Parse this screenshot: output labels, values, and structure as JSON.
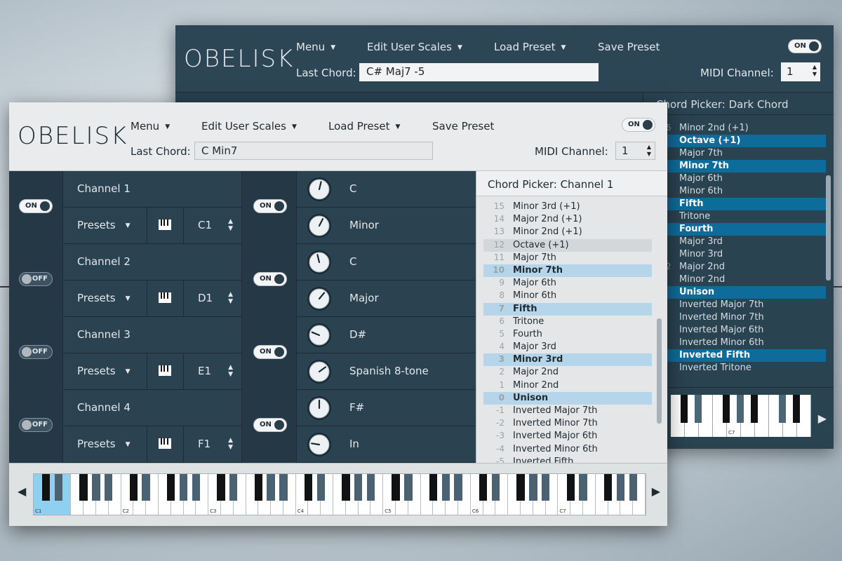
{
  "back_window": {
    "logo": "OBELISK",
    "menu": [
      "Menu",
      "Edit User Scales",
      "Load Preset",
      "Save Preset"
    ],
    "last_chord_label": "Last Chord:",
    "last_chord_value": "C# Maj7 -5",
    "midi_label": "MIDI Channel:",
    "midi_value": "1",
    "toggle_label": "ON",
    "picker_title": "Chord Picker: Dark Chord",
    "picker_items": [
      {
        "n": "6",
        "label": "Minor 2nd (+1)",
        "hl": false
      },
      {
        "n": "",
        "label": "Octave (+1)",
        "hl": true
      },
      {
        "n": "",
        "label": "Major 7th",
        "hl": false
      },
      {
        "n": "",
        "label": "Minor 7th",
        "hl": true
      },
      {
        "n": "",
        "label": "Major 6th",
        "hl": false
      },
      {
        "n": "",
        "label": "Minor 6th",
        "hl": false
      },
      {
        "n": "",
        "label": "Fifth",
        "hl": true
      },
      {
        "n": "",
        "label": "Tritone",
        "hl": false
      },
      {
        "n": "",
        "label": "Fourth",
        "hl": true
      },
      {
        "n": "",
        "label": "Major 3rd",
        "hl": false
      },
      {
        "n": "",
        "label": "Minor 3rd",
        "hl": false
      },
      {
        "n": "2",
        "label": "Major 2nd",
        "hl": false
      },
      {
        "n": "",
        "label": "Minor 2nd",
        "hl": false
      },
      {
        "n": "",
        "label": "Unison",
        "hl": true
      },
      {
        "n": "",
        "label": "Inverted Major 7th",
        "hl": false
      },
      {
        "n": "",
        "label": "Inverted Minor 7th",
        "hl": false
      },
      {
        "n": "",
        "label": "Inverted Major 6th",
        "hl": false
      },
      {
        "n": "",
        "label": "Inverted Minor 6th",
        "hl": false
      },
      {
        "n": "",
        "label": "Inverted Fifth",
        "hl": true
      },
      {
        "n": "",
        "label": "Inverted Tritone",
        "hl": false
      }
    ],
    "octave_label": "C7"
  },
  "window": {
    "logo": "OBELISK",
    "menu": {
      "menu": "Menu",
      "edit_scales": "Edit User Scales",
      "load_preset": "Load Preset",
      "save_preset": "Save Preset"
    },
    "last_chord_label": "Last Chord:",
    "last_chord_value": "C Min7",
    "midi_label": "MIDI Channel:",
    "midi_value": "1",
    "toggle_label": "ON"
  },
  "channels": [
    {
      "name": "Channel 1",
      "on": true,
      "presets": "Presets",
      "note": "C1",
      "chord_on": true,
      "root": "C",
      "scale": "Minor"
    },
    {
      "name": "Channel 2",
      "on": false,
      "presets": "Presets",
      "note": "D1",
      "chord_on": true,
      "root": "C",
      "scale": "Major"
    },
    {
      "name": "Channel 3",
      "on": false,
      "presets": "Presets",
      "note": "E1",
      "chord_on": true,
      "root": "D#",
      "scale": "Spanish 8-tone"
    },
    {
      "name": "Channel 4",
      "on": false,
      "presets": "Presets",
      "note": "F1",
      "chord_on": true,
      "root": "F#",
      "scale": "In"
    }
  ],
  "toggle_text": {
    "on": "ON",
    "off": "OFF"
  },
  "picker": {
    "title": "Chord Picker: Channel 1",
    "items": [
      {
        "n": "15",
        "label": "Minor 3rd (+1)",
        "state": ""
      },
      {
        "n": "14",
        "label": "Major 2nd (+1)",
        "state": ""
      },
      {
        "n": "13",
        "label": "Minor 2nd (+1)",
        "state": ""
      },
      {
        "n": "12",
        "label": "Octave (+1)",
        "state": "sel"
      },
      {
        "n": "11",
        "label": "Major 7th",
        "state": ""
      },
      {
        "n": "10",
        "label": "Minor 7th",
        "state": "hl"
      },
      {
        "n": "9",
        "label": "Major 6th",
        "state": ""
      },
      {
        "n": "8",
        "label": "Minor 6th",
        "state": ""
      },
      {
        "n": "7",
        "label": "Fifth",
        "state": "hl"
      },
      {
        "n": "6",
        "label": "Tritone",
        "state": ""
      },
      {
        "n": "5",
        "label": "Fourth",
        "state": ""
      },
      {
        "n": "4",
        "label": "Major 3rd",
        "state": ""
      },
      {
        "n": "3",
        "label": "Minor 3rd",
        "state": "hl"
      },
      {
        "n": "2",
        "label": "Major 2nd",
        "state": ""
      },
      {
        "n": "1",
        "label": "Minor 2nd",
        "state": ""
      },
      {
        "n": "0",
        "label": "Unison",
        "state": "hl"
      },
      {
        "n": "-1",
        "label": "Inverted Major 7th",
        "state": ""
      },
      {
        "n": "-2",
        "label": "Inverted Minor 7th",
        "state": ""
      },
      {
        "n": "-3",
        "label": "Inverted Major 6th",
        "state": ""
      },
      {
        "n": "-4",
        "label": "Inverted Minor 6th",
        "state": ""
      },
      {
        "n": "-5",
        "label": "Inverted Fifth",
        "state": ""
      }
    ]
  },
  "keyboard": {
    "octaves": [
      "C1",
      "C2",
      "C3",
      "C4",
      "C5",
      "C6",
      "C7"
    ],
    "highlight_white_keys": [
      0,
      1,
      2
    ],
    "highlight_black_keys": [
      1
    ]
  },
  "knob_levels": [
    0.55,
    0.6,
    0.45,
    0.65,
    0.25,
    0.7,
    0.5,
    0.2
  ],
  "colors": {
    "panel": "#2b4351",
    "highlight": "#b5d6ea",
    "key_highlight": "#8fd0f0",
    "accent_dark": "#0e6c9a"
  }
}
